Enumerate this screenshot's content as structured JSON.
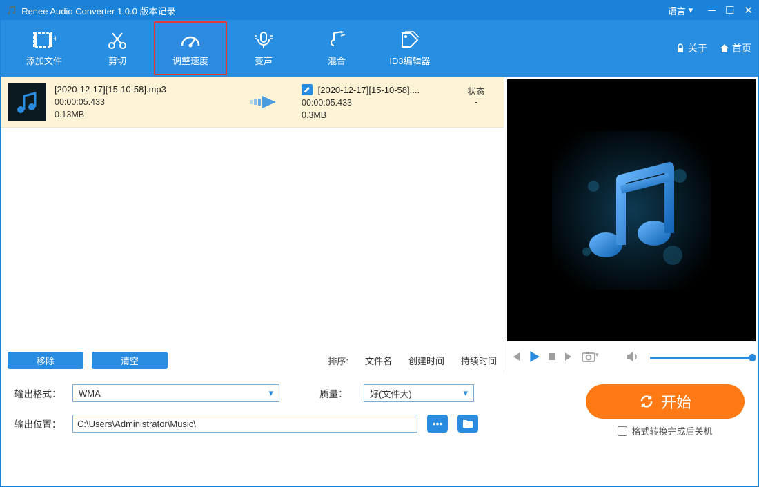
{
  "titlebar": {
    "app_icon": "🎵",
    "title": "Renee Audio Converter 1.0.0 版本记录",
    "language_label": "语言"
  },
  "toolbar": {
    "items": [
      {
        "label": "添加文件",
        "icon": "add-file"
      },
      {
        "label": "剪切",
        "icon": "cut"
      },
      {
        "label": "调整速度",
        "icon": "speed",
        "highlight": true
      },
      {
        "label": "变声",
        "icon": "voice"
      },
      {
        "label": "混合",
        "icon": "mix"
      },
      {
        "label": "ID3编辑器",
        "icon": "id3"
      }
    ],
    "right": {
      "about": "关于",
      "home": "首页"
    }
  },
  "file": {
    "src": {
      "name": "[2020-12-17][15-10-58].mp3",
      "duration": "00:00:05.433",
      "size": "0.13MB"
    },
    "dst": {
      "name": "[2020-12-17][15-10-58]....",
      "duration": "00:00:05.433",
      "size": "0.3MB"
    },
    "status_label": "状态",
    "status_value": "-"
  },
  "actions": {
    "remove": "移除",
    "clear": "清空"
  },
  "sort": {
    "label": "排序:",
    "by_name": "文件名",
    "by_created": "创建时间",
    "by_duration": "持续时间"
  },
  "output": {
    "format_label": "输出格式：",
    "format_value": "WMA",
    "quality_label": "质量：",
    "quality_value": "好(文件大)",
    "location_label": "输出位置：",
    "location_value": "C:\\Users\\Administrator\\Music\\"
  },
  "start": {
    "label": "开始",
    "shutdown": "格式转换完成后关机"
  }
}
